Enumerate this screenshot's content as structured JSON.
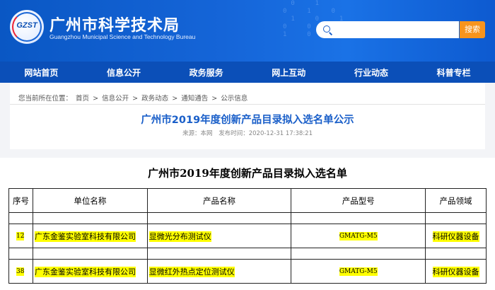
{
  "header": {
    "logo_text": "GZST",
    "title": "广州市科学技术局",
    "subtitle": "Guangzhou Municipal Science and Technology Bureau",
    "search_button": "搜索",
    "search_placeholder": ""
  },
  "nav": {
    "items": [
      "网站首页",
      "信息公开",
      "政务服务",
      "网上互动",
      "行业动态",
      "科普专栏"
    ]
  },
  "breadcrumb": {
    "prefix": "您当前所在位置：",
    "items": [
      "首页",
      "信息公开",
      "政务动态",
      "通知通告",
      "公示信息"
    ],
    "separator": ">"
  },
  "article": {
    "title": "广州市2019年度创新产品目录拟入选名单公示",
    "source": "来源：本网",
    "published": "发布时间：2020-12-31 17:38:21"
  },
  "document": {
    "title": "广州市2019年度创新产品目录拟入选名单",
    "table": {
      "headers": [
        "序号",
        "单位名称",
        "产品名称",
        "产品型号",
        "产品领域"
      ],
      "rows": [
        [
          "12",
          "广东金鉴实验室科技有限公司",
          "显微光分布测试仪",
          "GMATG-M5",
          "科研仪器设备"
        ],
        [
          "38",
          "广东金鉴实验室科技有限公司",
          "显微红外热点定位测试仪",
          "GMATG-M5",
          "科研仪器设备"
        ]
      ]
    }
  },
  "colors": {
    "header_blue": "#1565d8",
    "nav_blue": "#0b4fb8",
    "search_orange": "#f7941d",
    "title_blue": "#1a5fc9",
    "highlight": "#ffff00"
  }
}
